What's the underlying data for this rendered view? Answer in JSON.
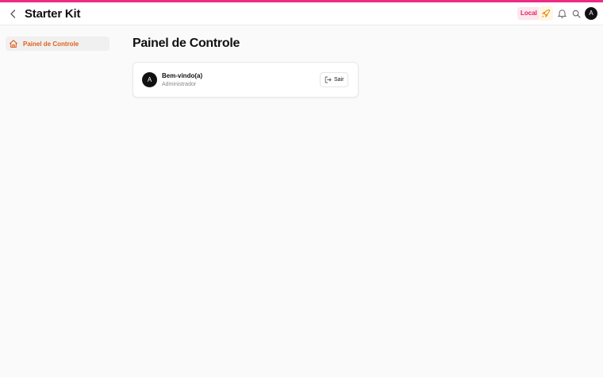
{
  "header": {
    "title": "Starter Kit",
    "env_badge": "Local",
    "user_initial": "A",
    "icons": [
      "chevron-left-icon",
      "rocket-icon",
      "bell-icon",
      "search-icon"
    ]
  },
  "sidebar": {
    "items": [
      {
        "label": "Painel de Controle",
        "icon": "home-icon"
      }
    ]
  },
  "main": {
    "title": "Painel de Controle",
    "card": {
      "avatar_initial": "A",
      "welcome": "Bem-vindo(a)",
      "role": "Administrador",
      "logout_label": "Sair",
      "logout_icon": "logout-icon"
    }
  },
  "colors": {
    "accent_top": "#ec2b84",
    "active_nav": "#e2601c",
    "badge_text": "#e0245e",
    "badge_bg": "#fde8ef"
  }
}
